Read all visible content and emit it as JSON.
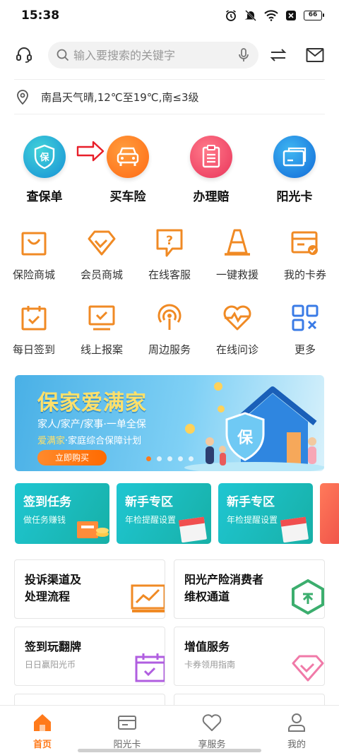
{
  "status": {
    "time": "15:38",
    "battery": "66"
  },
  "header": {
    "search_placeholder": "输入要搜索的关键字"
  },
  "weather": {
    "text": "南昌天气晴,12℃至19℃,南≤3级"
  },
  "main_items": [
    {
      "label": "查保单",
      "icon": "policy-icon",
      "color": "#1ba4d8"
    },
    {
      "label": "买车险",
      "icon": "car-icon",
      "color": "#ff7a1a"
    },
    {
      "label": "办理赔",
      "icon": "claim-icon",
      "color": "#f24e6b"
    },
    {
      "label": "阳光卡",
      "icon": "card-icon",
      "color": "#1c8fe0"
    }
  ],
  "grid_row1": [
    {
      "label": "保险商城",
      "icon": "shopping-bag-icon"
    },
    {
      "label": "会员商城",
      "icon": "diamond-icon"
    },
    {
      "label": "在线客服",
      "icon": "question-chat-icon"
    },
    {
      "label": "一键救援",
      "icon": "traffic-cone-icon"
    },
    {
      "label": "我的卡券",
      "icon": "coupon-icon"
    }
  ],
  "grid_row2": [
    {
      "label": "每日签到",
      "icon": "calendar-check-icon"
    },
    {
      "label": "线上报案",
      "icon": "monitor-check-icon"
    },
    {
      "label": "周边服务",
      "icon": "location-signal-icon"
    },
    {
      "label": "在线问诊",
      "icon": "heartbeat-icon"
    },
    {
      "label": "更多",
      "icon": "more-grid-icon"
    }
  ],
  "banner": {
    "title": "保家爱满家",
    "sub1": "家人/家产/家事·一单全保",
    "sub2_highlight": "爱满家",
    "sub2_rest": "·家庭综合保障计划",
    "button": "立即购买",
    "badge": "保"
  },
  "tasks": [
    {
      "title": "签到任务",
      "sub": "做任务赚钱"
    },
    {
      "title": "新手专区",
      "sub": "年检提醒设置"
    },
    {
      "title": "新手专区",
      "sub": "年检提醒设置"
    }
  ],
  "services": [
    {
      "title": "投诉渠道及",
      "title2": "处理流程",
      "sub": ""
    },
    {
      "title": "阳光产险消费者",
      "title2": "维权通道",
      "sub": ""
    },
    {
      "title": "签到玩翻牌",
      "title2": "",
      "sub": "日日赢阳光币"
    },
    {
      "title": "增值服务",
      "title2": "",
      "sub": "卡券领用指南"
    }
  ],
  "tabs": [
    {
      "label": "首页",
      "icon": "home-icon",
      "active": true
    },
    {
      "label": "阳光卡",
      "icon": "card-icon",
      "active": false
    },
    {
      "label": "享服务",
      "icon": "heart-icon",
      "active": false
    },
    {
      "label": "我的",
      "icon": "user-icon",
      "active": false
    }
  ],
  "colors": {
    "accent": "#ff7a1a",
    "orange_icon": "#f08a24"
  }
}
